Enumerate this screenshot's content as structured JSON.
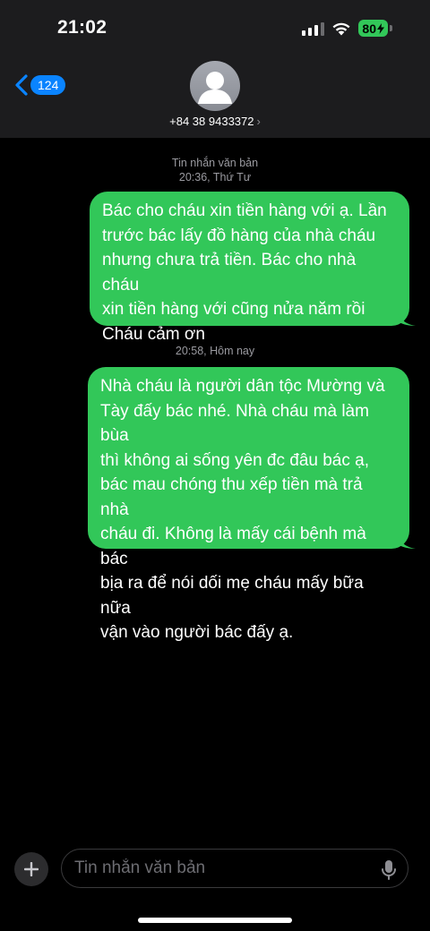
{
  "status": {
    "time": "21:02",
    "battery": "80"
  },
  "nav": {
    "back_count": "124",
    "contact": "+84 38 9433372",
    "contact_chevron": "›"
  },
  "thread": {
    "service_label": "Tin nhắn văn bản",
    "stamp1": "20:36, Thứ Tư",
    "stamp2": "20:58, Hôm nay",
    "messages": [
      {
        "lines": [
          "Bác cho cháu xin tiền hàng với ạ. Lần",
          "trước bác lấy đồ hàng của nhà cháu",
          "nhưng chưa trả tiền. Bác cho nhà cháu",
          "xin tiền hàng với cũng nửa năm rồi",
          "Cháu cảm ơn"
        ]
      },
      {
        "lines": [
          "Nhà cháu là người dân tộc Mường và",
          "Tày đấy bác nhé. Nhà cháu mà làm bùa",
          "thì không ai sống yên đc đâu bác ạ,",
          "bác mau chóng thu xếp tiền mà trả nhà",
          "cháu đi. Không là mấy cái bệnh mà bác",
          "bịa ra để nói dối mẹ cháu mấy bữa nữa",
          "vận vào người bác đấy ạ."
        ]
      }
    ]
  },
  "compose": {
    "placeholder": "Tin nhắn văn bản"
  },
  "colors": {
    "bubble": "#32c759",
    "accent": "#0a84ff",
    "header": "#1c1c1e"
  }
}
